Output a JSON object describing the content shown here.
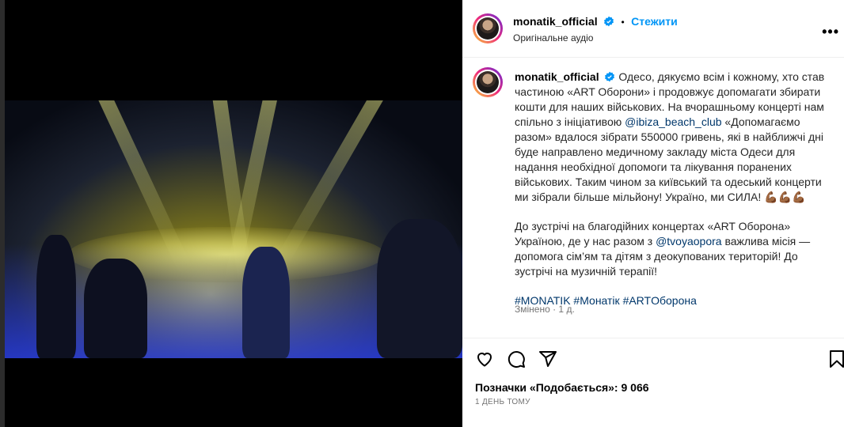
{
  "post": {
    "username": "monatik_official",
    "follow_label": "Стежити",
    "separator": "•",
    "audio_label": "Оригінальне аудіо",
    "more_label": "•••"
  },
  "caption": {
    "username": "monatik_official",
    "p1_a": "Одесо, дякуємо всім і кожному, хто став частиною «ART Оборони» і продовжує допомагати збирати кошти для наших військових. На вчорашньому концерті нам спільно з ініціативою ",
    "mention1": "@ibiza_beach_club",
    "p1_b": " «Допомагаємо разом» вдалося зібрати 550000 гривень, які в найближчі дні буде направлено медичному закладу міста Одеси для надання необхідної допомоги та лікування поранених військових. Таким чином за київський та одеський концерти ми зібрали більше мільйону! Україно, ми СИЛА! ",
    "emoji": "💪🏾💪🏾💪🏾",
    "p2_a": "До зустрічі на благодійних концертах «ART Оборона» Україною, де у нас разом з ",
    "mention2": "@tvoyaopora",
    "p2_b": " важлива місія — допомога сім’ям та дітям з деокупованих територій! До зустрічі на музичній терапії!",
    "tag1": "#MONATIK",
    "tag2": "#Монатік",
    "tag3": "#ARTОборона",
    "edited": "Змінено · 1 д."
  },
  "engagement": {
    "likes_text": "Позначки «Подобається»: 9 066",
    "date_text": "1 ДЕНЬ ТОМУ"
  },
  "icons": {
    "heart": "heart-icon",
    "comment": "comment-icon",
    "share": "share-icon",
    "save": "bookmark-icon",
    "mute": "muted-speaker-icon",
    "verified": "verified-badge-icon"
  },
  "colors": {
    "accent": "#0095f6",
    "verified": "#0095f6",
    "link": "#00376b"
  }
}
